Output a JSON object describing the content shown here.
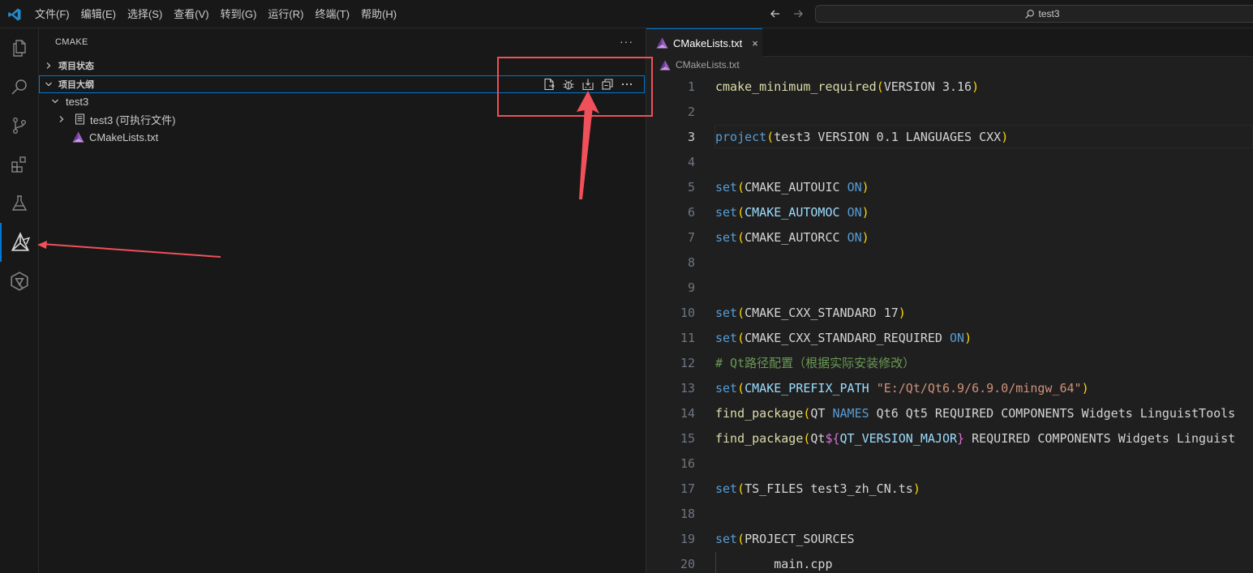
{
  "titlebar": {
    "menu": [
      "文件(F)",
      "编辑(E)",
      "选择(S)",
      "查看(V)",
      "转到(G)",
      "运行(R)",
      "终端(T)",
      "帮助(H)"
    ],
    "search_text": "test3",
    "accent": "#0078d4"
  },
  "activitybar": {
    "items": [
      {
        "name": "explorer-icon",
        "active": false
      },
      {
        "name": "search-icon",
        "active": false
      },
      {
        "name": "source-control-icon",
        "active": false
      },
      {
        "name": "extensions-icon",
        "active": false
      },
      {
        "name": "testing-icon",
        "active": false
      },
      {
        "name": "cmake-icon",
        "active": true
      },
      {
        "name": "qt-icon",
        "active": false
      }
    ]
  },
  "sidebar": {
    "title": "CMAKE",
    "more": "···",
    "sections": [
      {
        "label": "项目状态",
        "expanded": false
      },
      {
        "label": "项目大纲",
        "expanded": true
      }
    ],
    "outline_actions": [
      "configure-file-icon",
      "debug-icon",
      "build-icon",
      "collapse-all-icon",
      "more-actions-icon"
    ],
    "tree": [
      {
        "label": "test3",
        "level": 1,
        "expanded": true
      },
      {
        "label": "test3 (可执行文件)",
        "level": 2,
        "expanded": false
      },
      {
        "label": "CMakeLists.txt",
        "level": 2,
        "file": true
      }
    ]
  },
  "editor": {
    "tab": {
      "label": "CMakeLists.txt",
      "close": "×"
    },
    "breadcrumb": "CMakeLists.txt",
    "current_line": 3,
    "lines": [
      {
        "n": "1",
        "tokens": [
          [
            "fn2",
            "cmake_minimum_required"
          ],
          [
            "paren",
            "("
          ],
          [
            "txt",
            "VERSION 3.16"
          ],
          [
            "paren",
            ")"
          ]
        ]
      },
      {
        "n": "2",
        "tokens": []
      },
      {
        "n": "3",
        "tokens": [
          [
            "fn",
            "project"
          ],
          [
            "paren",
            "("
          ],
          [
            "txt",
            "test3 VERSION 0.1 LANGUAGES CXX"
          ],
          [
            "paren",
            ")"
          ]
        ]
      },
      {
        "n": "4",
        "tokens": []
      },
      {
        "n": "5",
        "tokens": [
          [
            "fn",
            "set"
          ],
          [
            "paren",
            "("
          ],
          [
            "txt",
            "CMAKE_AUTOUIC "
          ],
          [
            "kw",
            "ON"
          ],
          [
            "paren",
            ")"
          ]
        ]
      },
      {
        "n": "6",
        "tokens": [
          [
            "fn",
            "set"
          ],
          [
            "paren",
            "("
          ],
          [
            "var",
            "CMAKE_AUTOMOC"
          ],
          [
            "txt",
            " "
          ],
          [
            "kw",
            "ON"
          ],
          [
            "paren",
            ")"
          ]
        ]
      },
      {
        "n": "7",
        "tokens": [
          [
            "fn",
            "set"
          ],
          [
            "paren",
            "("
          ],
          [
            "txt",
            "CMAKE_AUTORCC "
          ],
          [
            "kw",
            "ON"
          ],
          [
            "paren",
            ")"
          ]
        ]
      },
      {
        "n": "8",
        "tokens": []
      },
      {
        "n": "9",
        "tokens": []
      },
      {
        "n": "10",
        "tokens": [
          [
            "fn",
            "set"
          ],
          [
            "paren",
            "("
          ],
          [
            "txt",
            "CMAKE_CXX_STANDARD 17"
          ],
          [
            "paren",
            ")"
          ]
        ]
      },
      {
        "n": "11",
        "tokens": [
          [
            "fn",
            "set"
          ],
          [
            "paren",
            "("
          ],
          [
            "txt",
            "CMAKE_CXX_STANDARD_REQUIRED "
          ],
          [
            "kw",
            "ON"
          ],
          [
            "paren",
            ")"
          ]
        ]
      },
      {
        "n": "12",
        "tokens": [
          [
            "com",
            "# Qt路径配置（根据实际安装修改）"
          ]
        ]
      },
      {
        "n": "13",
        "tokens": [
          [
            "fn",
            "set"
          ],
          [
            "paren",
            "("
          ],
          [
            "var",
            "CMAKE_PREFIX_PATH"
          ],
          [
            "txt",
            " "
          ],
          [
            "str",
            "\"E:/Qt/Qt6.9/6.9.0/mingw_64\""
          ],
          [
            "paren",
            ")"
          ]
        ]
      },
      {
        "n": "14",
        "tokens": [
          [
            "fn2",
            "find_package"
          ],
          [
            "paren",
            "("
          ],
          [
            "txt",
            "QT "
          ],
          [
            "kw",
            "NAMES"
          ],
          [
            "txt",
            " Qt6 Qt5 REQUIRED COMPONENTS Widgets LinguistTools"
          ]
        ]
      },
      {
        "n": "15",
        "tokens": [
          [
            "fn2",
            "find_package"
          ],
          [
            "paren",
            "("
          ],
          [
            "txt",
            "Qt"
          ],
          [
            "brace",
            "${"
          ],
          [
            "var",
            "QT_VERSION_MAJOR"
          ],
          [
            "brace",
            "}"
          ],
          [
            "txt",
            " REQUIRED COMPONENTS Widgets Linguist"
          ]
        ]
      },
      {
        "n": "16",
        "tokens": []
      },
      {
        "n": "17",
        "tokens": [
          [
            "fn",
            "set"
          ],
          [
            "paren",
            "("
          ],
          [
            "txt",
            "TS_FILES test3_zh_CN.ts"
          ],
          [
            "paren",
            ")"
          ]
        ]
      },
      {
        "n": "18",
        "tokens": []
      },
      {
        "n": "19",
        "tokens": [
          [
            "fn",
            "set"
          ],
          [
            "paren",
            "("
          ],
          [
            "txt",
            "PROJECT_SOURCES"
          ]
        ]
      },
      {
        "n": "20",
        "tokens": [
          [
            "txt",
            "        main.cpp"
          ]
        ],
        "guide": true
      }
    ]
  },
  "annotation": {
    "color": "#f0505a"
  }
}
